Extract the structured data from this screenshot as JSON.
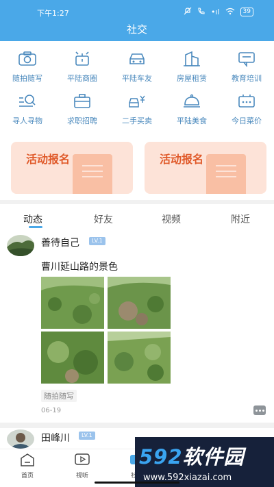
{
  "status_bar": {
    "time": "下午1:27",
    "signal_text": "•ıl",
    "battery": "39"
  },
  "header": {
    "title": "社交"
  },
  "categories": [
    {
      "label": "随拍随写",
      "icon": "camera-icon"
    },
    {
      "label": "平陆商圈",
      "icon": "alarm-clock-icon"
    },
    {
      "label": "平陆车友",
      "icon": "car-icon"
    },
    {
      "label": "房屋租赁",
      "icon": "building-icon"
    },
    {
      "label": "教育培训",
      "icon": "chat-bubble-icon"
    },
    {
      "label": "寻人寻物",
      "icon": "search-list-icon"
    },
    {
      "label": "求职招聘",
      "icon": "briefcase-icon"
    },
    {
      "label": "二手买卖",
      "icon": "car-yen-icon"
    },
    {
      "label": "平陆美食",
      "icon": "food-cloche-icon"
    },
    {
      "label": "今日菜价",
      "icon": "monitor-dots-icon"
    }
  ],
  "activity_cards": [
    {
      "label": "活动报名"
    },
    {
      "label": "活动报名"
    }
  ],
  "tabs": [
    {
      "label": "动态",
      "active": true
    },
    {
      "label": "好友"
    },
    {
      "label": "视频"
    },
    {
      "label": "附近"
    }
  ],
  "posts": [
    {
      "user": "善待自己",
      "level": "LV.1",
      "text": "曹川延山路的景色",
      "tag": "随拍随写",
      "date": "06-19"
    },
    {
      "user": "田峰川",
      "level": "LV.1"
    }
  ],
  "bottom_nav": [
    {
      "label": "首页",
      "icon": "home-icon"
    },
    {
      "label": "视听",
      "icon": "video-play-icon"
    },
    {
      "label": "社交",
      "icon": "social-icon",
      "active": true
    },
    {
      "label": "",
      "icon": "share-icon"
    },
    {
      "label": "",
      "icon": "profile-icon"
    }
  ],
  "watermark": {
    "brand_prefix": "592",
    "brand_suffix": "软件园",
    "url": "www.592xiazai.com"
  },
  "colors": {
    "primary": "#4aa8e8",
    "category_text": "#4a89bd",
    "activity_bg": "#fde3d8",
    "activity_text": "#e05a2a"
  }
}
